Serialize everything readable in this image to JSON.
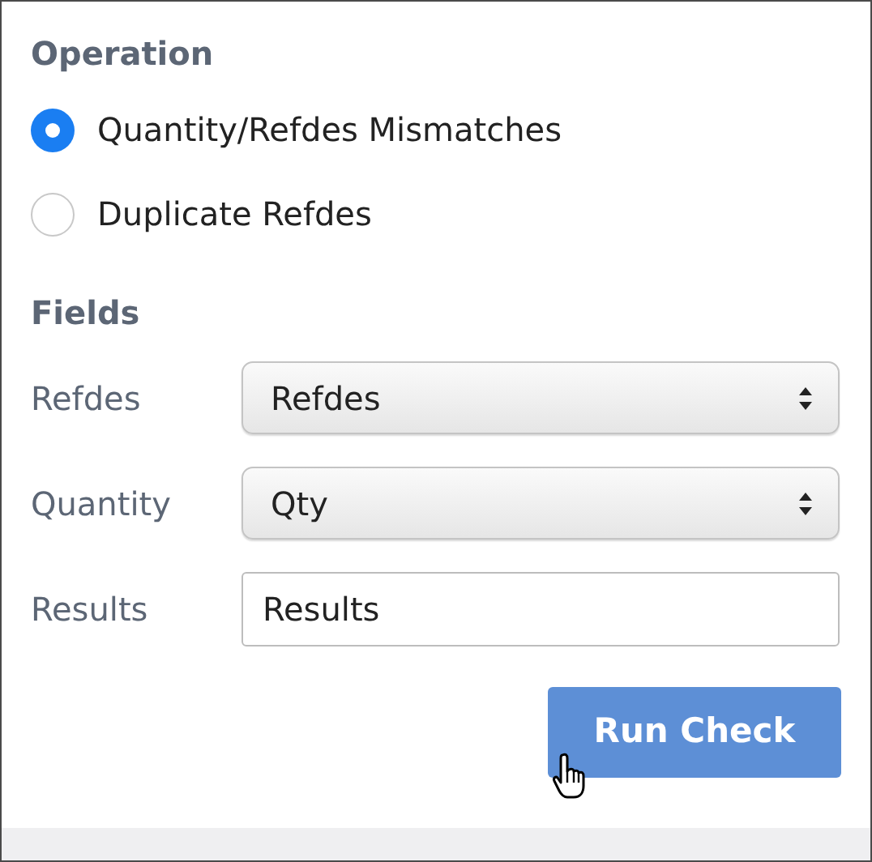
{
  "operation": {
    "heading": "Operation",
    "options": [
      {
        "label": "Quantity/Refdes Mismatches",
        "selected": true
      },
      {
        "label": "Duplicate Refdes",
        "selected": false
      }
    ]
  },
  "fields": {
    "heading": "Fields",
    "rows": [
      {
        "kind": "select",
        "label": "Refdes",
        "value": "Refdes"
      },
      {
        "kind": "select",
        "label": "Quantity",
        "value": "Qty"
      },
      {
        "kind": "input",
        "label": "Results",
        "value": "Results"
      }
    ]
  },
  "button": "Run Check"
}
